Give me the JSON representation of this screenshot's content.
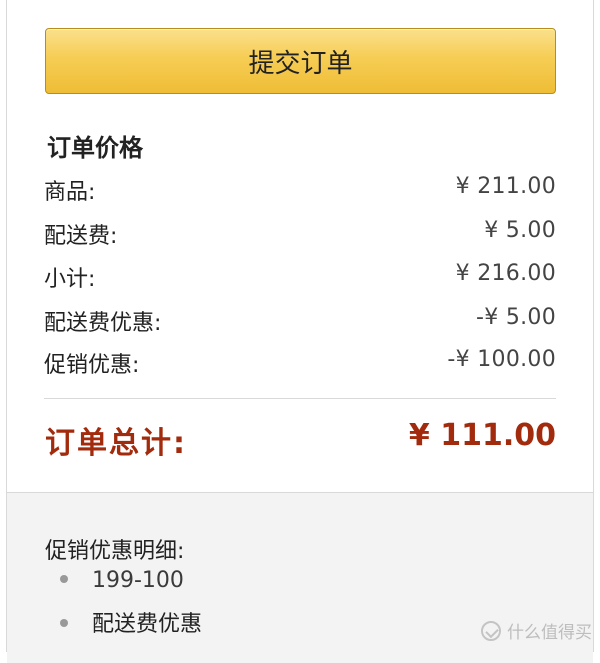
{
  "actions": {
    "submit_label": "提交订单"
  },
  "summary": {
    "title": "订单价格",
    "rows": [
      {
        "label": "商品:",
        "value": "¥ 211.00"
      },
      {
        "label": "配送费:",
        "value": "¥ 5.00"
      },
      {
        "label": "小计:",
        "value": "¥ 216.00"
      },
      {
        "label": "配送费优惠:",
        "value": "-¥ 5.00"
      },
      {
        "label": "促销优惠:",
        "value": "-¥ 100.00"
      }
    ],
    "total_label": "订单总计:",
    "total_value": "¥ 111.00"
  },
  "promotions": {
    "title": "促销优惠明细:",
    "items": [
      "199-100",
      "配送费优惠"
    ]
  },
  "watermark": {
    "text": "什么值得买"
  },
  "colors": {
    "accent": "#a32b0d",
    "button": "#f6cd54"
  }
}
